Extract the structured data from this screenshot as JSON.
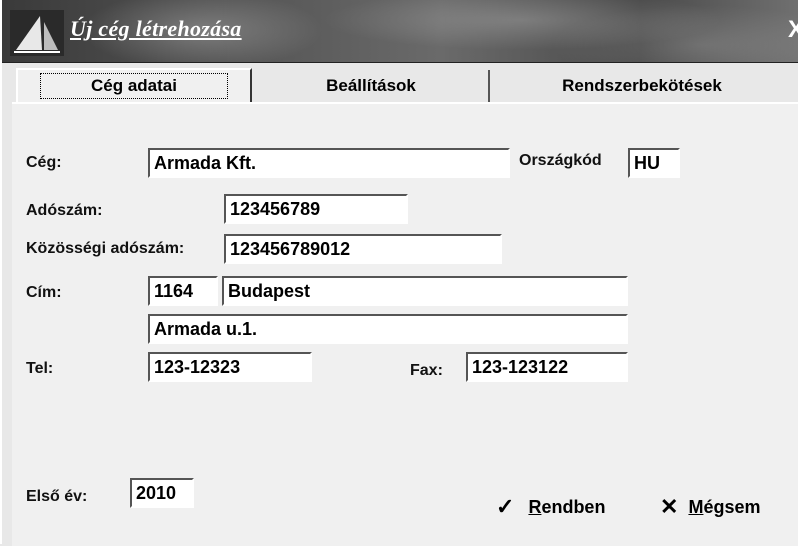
{
  "window": {
    "title": "Új cég létrehozása",
    "close_glyph": "X"
  },
  "tabs": [
    {
      "label": "Cég adatai",
      "active": true
    },
    {
      "label": "Beállítások",
      "active": false
    },
    {
      "label": "Rendszerbekötések",
      "active": false
    }
  ],
  "form": {
    "company_label": "Cég:",
    "company_value": "Armada Kft.",
    "country_label": "Országkód",
    "country_value": "HU",
    "tax_label": "Adószám:",
    "tax_value": "123456789",
    "eu_tax_label": "Közösségi adószám:",
    "eu_tax_value": "123456789012",
    "address_label": "Cím:",
    "zip_value": "1164",
    "city_value": "Budapest",
    "street_value": "Armada u.1.",
    "phone_label": "Tel:",
    "phone_value": "123-12323",
    "fax_label": "Fax:",
    "fax_value": "123-123122",
    "first_year_label": "Első év:",
    "first_year_value": "2010"
  },
  "buttons": {
    "ok_icon": "checkmark-icon",
    "ok_first": "R",
    "ok_rest": "endben",
    "cancel_icon": "x-icon",
    "cancel_first": "M",
    "cancel_rest": "égsem"
  }
}
